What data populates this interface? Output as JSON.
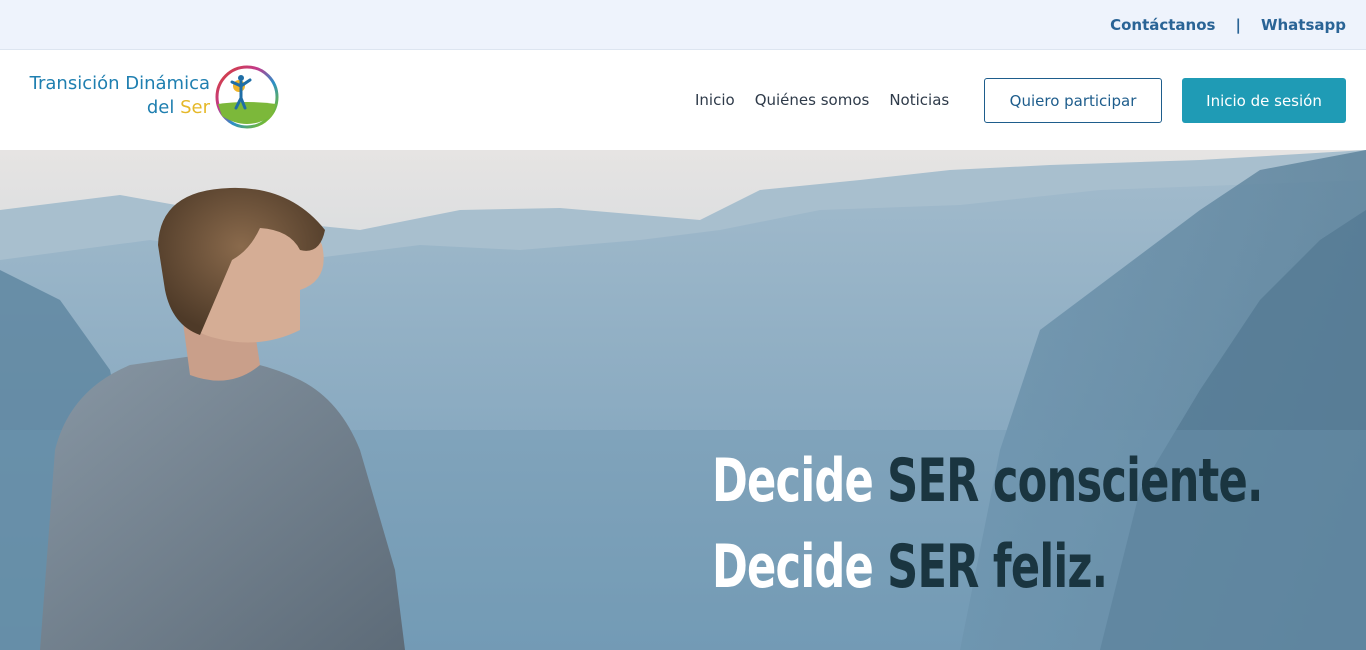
{
  "topbar": {
    "contact_label": "Contáctanos",
    "separator": "|",
    "whatsapp_label": "Whatsapp"
  },
  "logo": {
    "line1": "Transición Dinámica",
    "line2_a": "del ",
    "line2_b": "Ser"
  },
  "nav": {
    "items": [
      {
        "label": "Inicio"
      },
      {
        "label": "Quiénes somos"
      },
      {
        "label": "Noticias"
      }
    ],
    "participate_label": "Quiero participar",
    "login_label": "Inicio de sesión"
  },
  "hero": {
    "line1_a": "Decide ",
    "line1_b": "SER consciente.",
    "line2_a": "Decide ",
    "line2_b": "SER feliz."
  },
  "colors": {
    "accent": "#1f9bb5",
    "brand_blue": "#1e5d8c",
    "topbar_bg": "#eef3fc",
    "hero_dark_text": "#1a3540"
  }
}
